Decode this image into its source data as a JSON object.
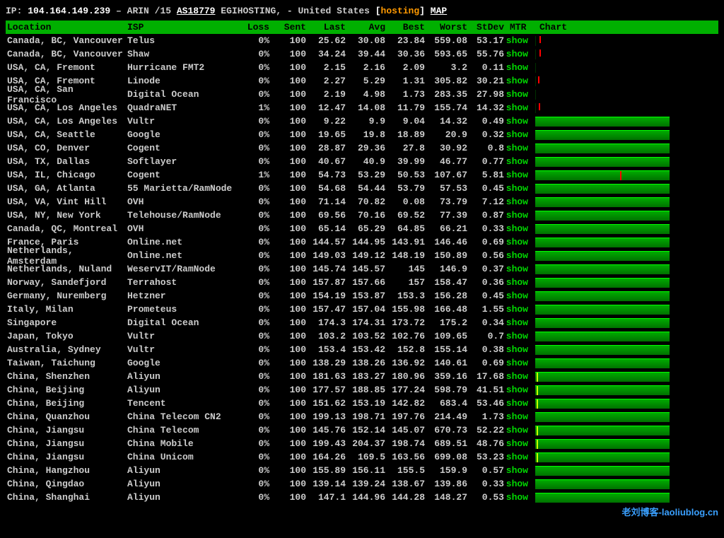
{
  "header": {
    "prefix": "IP: ",
    "ip": "104.164.149.239",
    "arin": " – ARIN /15 ",
    "as": "AS18779",
    "egi": " EGIHOSTING, - United States ",
    "bracket_open": "[",
    "hosting": "hosting",
    "bracket_close": "] ",
    "map": "MAP"
  },
  "columns": {
    "location": "Location",
    "isp": "ISP",
    "loss": "Loss",
    "sent": "Sent",
    "last": "Last",
    "avg": "Avg",
    "best": "Best",
    "worst": "Worst",
    "stdev": "StDev",
    "mtr": "MTR",
    "chart": "Chart"
  },
  "mtr_label": "show",
  "rows": [
    {
      "location": "Canada, BC, Vancouver",
      "isp": "Telus",
      "loss": "0%",
      "sent": "100",
      "last": "25.62",
      "avg": "30.08",
      "best": "23.84",
      "worst": "559.08",
      "stdev": "53.17",
      "chart": "empty",
      "spike": 5
    },
    {
      "location": "Canada, BC, Vancouver",
      "isp": "Shaw",
      "loss": "0%",
      "sent": "100",
      "last": "34.24",
      "avg": "39.44",
      "best": "30.36",
      "worst": "593.65",
      "stdev": "55.76",
      "chart": "empty",
      "spike": 5
    },
    {
      "location": "USA, CA, Fremont",
      "isp": "Hurricane FMT2",
      "loss": "0%",
      "sent": "100",
      "last": "2.15",
      "avg": "2.16",
      "best": "2.09",
      "worst": "3.2",
      "stdev": "0.11",
      "chart": "empty"
    },
    {
      "location": "USA, CA, Fremont",
      "isp": "Linode",
      "loss": "0%",
      "sent": "100",
      "last": "2.27",
      "avg": "5.29",
      "best": "1.31",
      "worst": "305.82",
      "stdev": "30.21",
      "chart": "empty",
      "spike": 3
    },
    {
      "location": "USA, CA, San Francisco",
      "isp": "Digital Ocean",
      "loss": "0%",
      "sent": "100",
      "last": "2.19",
      "avg": "4.98",
      "best": "1.73",
      "worst": "283.35",
      "stdev": "27.98",
      "chart": "empty"
    },
    {
      "location": "USA, CA, Los Angeles",
      "isp": "QuadraNET",
      "loss": "1%",
      "sent": "100",
      "last": "12.47",
      "avg": "14.08",
      "best": "11.79",
      "worst": "155.74",
      "stdev": "14.32",
      "chart": "empty",
      "spike": 4
    },
    {
      "location": "USA, CA, Los Angeles",
      "isp": "Vultr",
      "loss": "0%",
      "sent": "100",
      "last": "9.22",
      "avg": "9.9",
      "best": "9.04",
      "worst": "14.32",
      "stdev": "0.49",
      "chart": "full"
    },
    {
      "location": "USA, CA, Seattle",
      "isp": "Google",
      "loss": "0%",
      "sent": "100",
      "last": "19.65",
      "avg": "19.8",
      "best": "18.89",
      "worst": "20.9",
      "stdev": "0.32",
      "chart": "full"
    },
    {
      "location": "USA, CO, Denver",
      "isp": "Cogent",
      "loss": "0%",
      "sent": "100",
      "last": "28.87",
      "avg": "29.36",
      "best": "27.8",
      "worst": "30.92",
      "stdev": "0.8",
      "chart": "full"
    },
    {
      "location": "USA, TX, Dallas",
      "isp": "Softlayer",
      "loss": "0%",
      "sent": "100",
      "last": "40.67",
      "avg": "40.9",
      "best": "39.99",
      "worst": "46.77",
      "stdev": "0.77",
      "chart": "full"
    },
    {
      "location": "USA, IL, Chicago",
      "isp": "Cogent",
      "loss": "1%",
      "sent": "100",
      "last": "54.73",
      "avg": "53.29",
      "best": "50.53",
      "worst": "107.67",
      "stdev": "5.81",
      "chart": "full",
      "spike": 120
    },
    {
      "location": "USA, GA, Atlanta",
      "isp": "55 Marietta/RamNode",
      "loss": "0%",
      "sent": "100",
      "last": "54.68",
      "avg": "54.44",
      "best": "53.79",
      "worst": "57.53",
      "stdev": "0.45",
      "chart": "full"
    },
    {
      "location": "USA, VA, Vint Hill",
      "isp": "OVH",
      "loss": "0%",
      "sent": "100",
      "last": "71.14",
      "avg": "70.82",
      "best": "0.08",
      "worst": "73.79",
      "stdev": "7.12",
      "chart": "full"
    },
    {
      "location": "USA, NY, New York",
      "isp": "Telehouse/RamNode",
      "loss": "0%",
      "sent": "100",
      "last": "69.56",
      "avg": "70.16",
      "best": "69.52",
      "worst": "77.39",
      "stdev": "0.87",
      "chart": "full"
    },
    {
      "location": "Canada, QC, Montreal",
      "isp": "OVH",
      "loss": "0%",
      "sent": "100",
      "last": "65.14",
      "avg": "65.29",
      "best": "64.85",
      "worst": "66.21",
      "stdev": "0.33",
      "chart": "full"
    },
    {
      "location": "France, Paris",
      "isp": "Online.net",
      "loss": "0%",
      "sent": "100",
      "last": "144.57",
      "avg": "144.95",
      "best": "143.91",
      "worst": "146.46",
      "stdev": "0.69",
      "chart": "full"
    },
    {
      "location": "Netherlands, Amsterdam",
      "isp": "Online.net",
      "loss": "0%",
      "sent": "100",
      "last": "149.03",
      "avg": "149.12",
      "best": "148.19",
      "worst": "150.89",
      "stdev": "0.56",
      "chart": "full"
    },
    {
      "location": "Netherlands, Nuland",
      "isp": "WeservIT/RamNode",
      "loss": "0%",
      "sent": "100",
      "last": "145.74",
      "avg": "145.57",
      "best": "145",
      "worst": "146.9",
      "stdev": "0.37",
      "chart": "full"
    },
    {
      "location": "Norway, Sandefjord",
      "isp": "Terrahost",
      "loss": "0%",
      "sent": "100",
      "last": "157.87",
      "avg": "157.66",
      "best": "157",
      "worst": "158.47",
      "stdev": "0.36",
      "chart": "full"
    },
    {
      "location": "Germany, Nuremberg",
      "isp": "Hetzner",
      "loss": "0%",
      "sent": "100",
      "last": "154.19",
      "avg": "153.87",
      "best": "153.3",
      "worst": "156.28",
      "stdev": "0.45",
      "chart": "full"
    },
    {
      "location": "Italy, Milan",
      "isp": "Prometeus",
      "loss": "0%",
      "sent": "100",
      "last": "157.47",
      "avg": "157.04",
      "best": "155.98",
      "worst": "166.48",
      "stdev": "1.55",
      "chart": "full"
    },
    {
      "location": "Singapore",
      "isp": "Digital Ocean",
      "loss": "0%",
      "sent": "100",
      "last": "174.3",
      "avg": "174.31",
      "best": "173.72",
      "worst": "175.2",
      "stdev": "0.34",
      "chart": "full"
    },
    {
      "location": "Japan, Tokyo",
      "isp": "Vultr",
      "loss": "0%",
      "sent": "100",
      "last": "103.2",
      "avg": "103.52",
      "best": "102.76",
      "worst": "109.65",
      "stdev": "0.7",
      "chart": "full"
    },
    {
      "location": "Australia, Sydney",
      "isp": "Vultr",
      "loss": "0%",
      "sent": "100",
      "last": "153.4",
      "avg": "153.42",
      "best": "152.8",
      "worst": "155.14",
      "stdev": "0.38",
      "chart": "full"
    },
    {
      "location": "Taiwan, Taichung",
      "isp": "Google",
      "loss": "0%",
      "sent": "100",
      "last": "138.29",
      "avg": "138.26",
      "best": "136.92",
      "worst": "140.61",
      "stdev": "0.69",
      "chart": "full"
    },
    {
      "location": "China, Shenzhen",
      "isp": "Aliyun",
      "loss": "0%",
      "sent": "100",
      "last": "181.63",
      "avg": "183.27",
      "best": "180.96",
      "worst": "359.16",
      "stdev": "17.68",
      "chart": "full",
      "tick": true
    },
    {
      "location": "China, Beijing",
      "isp": "Aliyun",
      "loss": "0%",
      "sent": "100",
      "last": "177.57",
      "avg": "188.85",
      "best": "177.24",
      "worst": "598.79",
      "stdev": "41.51",
      "chart": "full",
      "tick": true
    },
    {
      "location": "China, Beijing",
      "isp": "Tencent",
      "loss": "0%",
      "sent": "100",
      "last": "151.62",
      "avg": "153.19",
      "best": "142.82",
      "worst": "683.4",
      "stdev": "53.46",
      "chart": "full",
      "tick": true
    },
    {
      "location": "China, Quanzhou",
      "isp": "China Telecom CN2",
      "loss": "0%",
      "sent": "100",
      "last": "199.13",
      "avg": "198.71",
      "best": "197.76",
      "worst": "214.49",
      "stdev": "1.73",
      "chart": "full"
    },
    {
      "location": "China, Jiangsu",
      "isp": "China Telecom",
      "loss": "0%",
      "sent": "100",
      "last": "145.76",
      "avg": "152.14",
      "best": "145.07",
      "worst": "670.73",
      "stdev": "52.22",
      "chart": "full",
      "tick": true
    },
    {
      "location": "China, Jiangsu",
      "isp": "China Mobile",
      "loss": "0%",
      "sent": "100",
      "last": "199.43",
      "avg": "204.37",
      "best": "198.74",
      "worst": "689.51",
      "stdev": "48.76",
      "chart": "full",
      "tick": true
    },
    {
      "location": "China, Jiangsu",
      "isp": "China Unicom",
      "loss": "0%",
      "sent": "100",
      "last": "164.26",
      "avg": "169.5",
      "best": "163.56",
      "worst": "699.08",
      "stdev": "53.23",
      "chart": "full",
      "tick": true
    },
    {
      "location": "China, Hangzhou",
      "isp": "Aliyun",
      "loss": "0%",
      "sent": "100",
      "last": "155.89",
      "avg": "156.11",
      "best": "155.5",
      "worst": "159.9",
      "stdev": "0.57",
      "chart": "full"
    },
    {
      "location": "China, Qingdao",
      "isp": "Aliyun",
      "loss": "0%",
      "sent": "100",
      "last": "139.14",
      "avg": "139.24",
      "best": "138.67",
      "worst": "139.86",
      "stdev": "0.33",
      "chart": "full"
    },
    {
      "location": "China, Shanghai",
      "isp": "Aliyun",
      "loss": "0%",
      "sent": "100",
      "last": "147.1",
      "avg": "144.96",
      "best": "144.28",
      "worst": "148.27",
      "stdev": "0.53",
      "chart": "full"
    }
  ],
  "watermark": "老刘博客-laoliublog.cn"
}
